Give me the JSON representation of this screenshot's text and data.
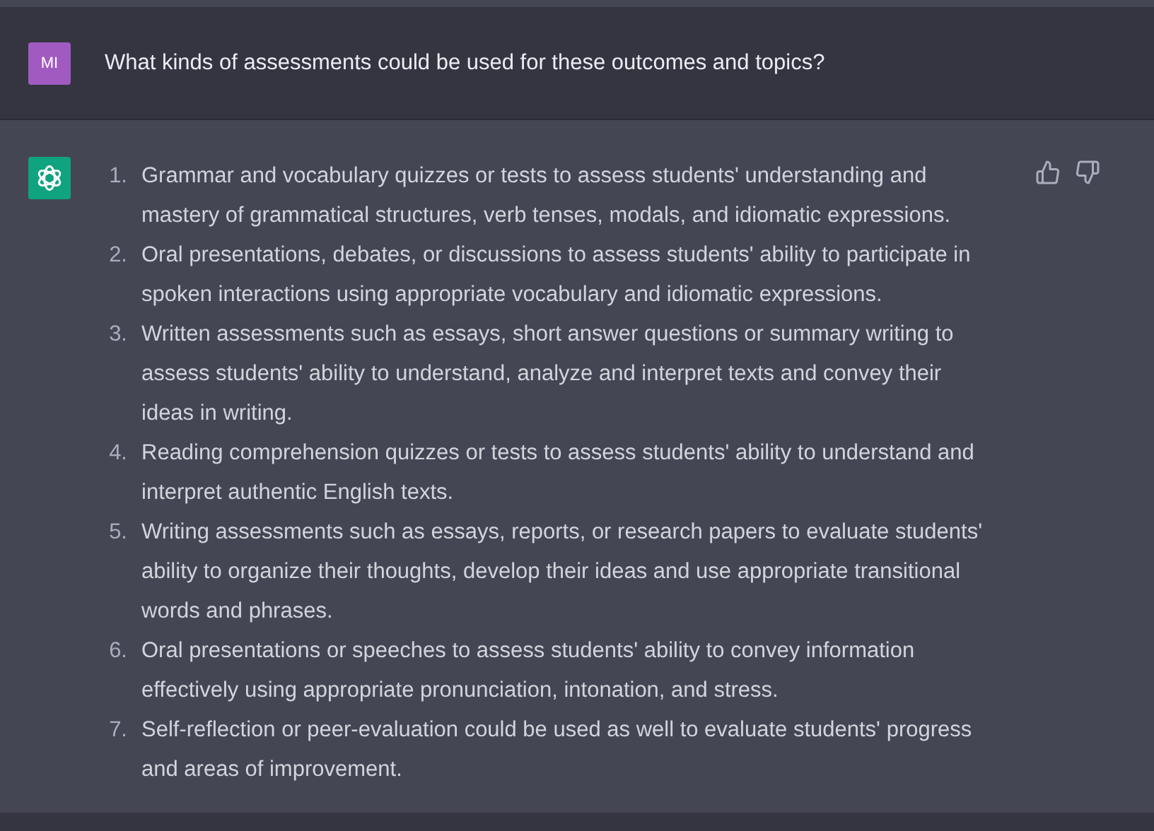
{
  "user_message": {
    "avatar": "MI",
    "text": "What kinds of assessments could be used for these outcomes and topics?"
  },
  "assistant_message": {
    "items": [
      {
        "number": "1.",
        "text": "Grammar and vocabulary quizzes or tests to assess students' understanding and mastery of grammatical structures, verb tenses, modals, and idiomatic expressions."
      },
      {
        "number": "2.",
        "text": "Oral presentations, debates, or discussions to assess students' ability to participate in spoken interactions using appropriate vocabulary and idiomatic expressions."
      },
      {
        "number": "3.",
        "text": "Written assessments such as essays, short answer questions or summary writing to assess students' ability to understand, analyze and interpret texts and convey their ideas in writing."
      },
      {
        "number": "4.",
        "text": "Reading comprehension quizzes or tests to assess students' ability to understand and interpret authentic English texts."
      },
      {
        "number": "5.",
        "text": "Writing assessments such as essays, reports, or research papers to evaluate students' ability to organize their thoughts, develop their ideas and use appropriate transitional words and phrases."
      },
      {
        "number": "6.",
        "text": "Oral presentations or speeches to assess students' ability to convey information effectively using appropriate pronunciation, intonation, and stress."
      },
      {
        "number": "7.",
        "text": "Self-reflection or peer-evaluation could be used as well to evaluate students' progress and areas of improvement."
      }
    ]
  }
}
